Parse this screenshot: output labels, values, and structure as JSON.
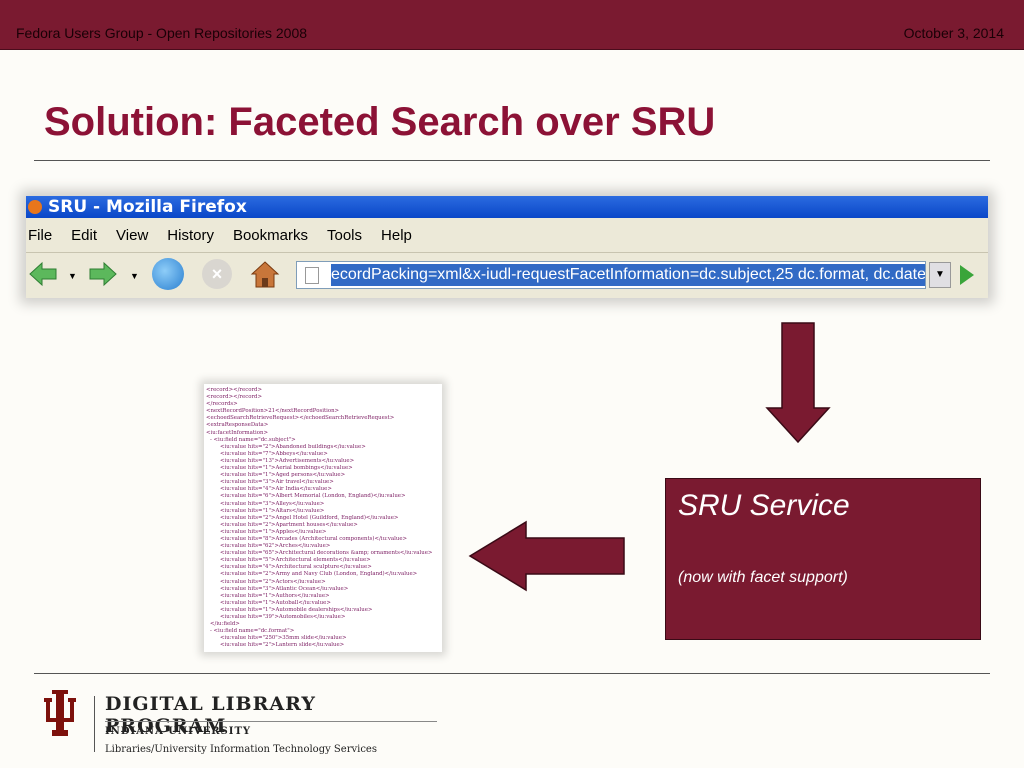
{
  "header": {
    "left": "Fedora Users Group - Open Repositories 2008",
    "right": "October 3, 2014"
  },
  "title": "Solution: Faceted Search over SRU",
  "browser": {
    "window_title": "SRU - Mozilla Firefox",
    "menu": [
      "File",
      "Edit",
      "View",
      "History",
      "Bookmarks",
      "Tools",
      "Help"
    ],
    "url": "ecordPacking=xml&x-iudl-requestFacetInformation=dc.subject,25 dc.format, dc.date,",
    "icons": [
      "back-icon",
      "forward-icon",
      "reload-icon",
      "stop-icon",
      "home-icon",
      "go-icon"
    ]
  },
  "xml_lines": [
    {
      "t": "<record></record>",
      "l": 0
    },
    {
      "t": "<record></record>",
      "l": 0
    },
    {
      "t": "</records>",
      "l": 0
    },
    {
      "t": "<nextRecordPosition>21</nextRecordPosition>",
      "l": 0
    },
    {
      "t": "<echoedSearchRetrieveRequest></echoedSearchRetrieveRequest>",
      "l": 0
    },
    {
      "t": "<extraResponseData>",
      "l": 0
    },
    {
      "t": "<iu:facetInformation>",
      "l": 0
    },
    {
      "t": "- <iu:field name=\"dc.subject\">",
      "l": 1
    },
    {
      "t": "<iu:value hits=\"2\">Abandoned buildings</iu:value>",
      "l": 2
    },
    {
      "t": "<iu:value hits=\"7\">Abbeys</iu:value>",
      "l": 2
    },
    {
      "t": "<iu:value hits=\"13\">Advertisements</iu:value>",
      "l": 2
    },
    {
      "t": "<iu:value hits=\"1\">Aerial bombings</iu:value>",
      "l": 2
    },
    {
      "t": "<iu:value hits=\"1\">Aged persons</iu:value>",
      "l": 2
    },
    {
      "t": "<iu:value hits=\"3\">Air travel</iu:value>",
      "l": 2
    },
    {
      "t": "<iu:value hits=\"4\">Air India</iu:value>",
      "l": 2
    },
    {
      "t": "<iu:value hits=\"6\">Albert Memorial (London, England)</iu:value>",
      "l": 2
    },
    {
      "t": "<iu:value hits=\"3\">Alleys</iu:value>",
      "l": 2
    },
    {
      "t": "<iu:value hits=\"1\">Altars</iu:value>",
      "l": 2
    },
    {
      "t": "<iu:value hits=\"2\">Angel Hotel (Guildford, England)</iu:value>",
      "l": 2
    },
    {
      "t": "<iu:value hits=\"2\">Apartment houses</iu:value>",
      "l": 2
    },
    {
      "t": "<iu:value hits=\"1\">Apples</iu:value>",
      "l": 2
    },
    {
      "t": "<iu:value hits=\"8\">Arcades (Architectural components)</iu:value>",
      "l": 2
    },
    {
      "t": "<iu:value hits=\"62\">Arches</iu:value>",
      "l": 2
    },
    {
      "t": "<iu:value hits=\"65\">Architectural decorations &amp; ornaments</iu:value>",
      "l": 2
    },
    {
      "t": "<iu:value hits=\"5\">Architectural elements</iu:value>",
      "l": 2
    },
    {
      "t": "<iu:value hits=\"4\">Architectural sculpture</iu:value>",
      "l": 2
    },
    {
      "t": "<iu:value hits=\"2\">Army and Navy Club (London, England)</iu:value>",
      "l": 2
    },
    {
      "t": "<iu:value hits=\"2\">Actors</iu:value>",
      "l": 2
    },
    {
      "t": "<iu:value hits=\"3\">Atlantic Ocean</iu:value>",
      "l": 2
    },
    {
      "t": "<iu:value hits=\"1\">Authors</iu:value>",
      "l": 2
    },
    {
      "t": "<iu:value hits=\"1\">Autoball</iu:value>",
      "l": 2
    },
    {
      "t": "<iu:value hits=\"1\">Automobile dealerships</iu:value>",
      "l": 2
    },
    {
      "t": "<iu:value hits=\"39\">Automobiles</iu:value>",
      "l": 2
    },
    {
      "t": "</iu:field>",
      "l": 1
    },
    {
      "t": "- <iu:field name=\"dc.format\">",
      "l": 1
    },
    {
      "t": "<iu:value hits=\"250\">35mm slide</iu:value>",
      "l": 2
    },
    {
      "t": "<iu:value hits=\"2\">Lantern slide</iu:value>",
      "l": 2
    }
  ],
  "sru_box": {
    "heading": "SRU Service",
    "subtext": "(now with facet support)"
  },
  "logo": {
    "line1": "DIGITAL LIBRARY PROGRAM",
    "line2": "INDIANA UNIVERSITY",
    "line3": "Libraries/University Information Technology Services"
  },
  "colors": {
    "accent": "#7a1a30",
    "title": "#8c1236"
  }
}
